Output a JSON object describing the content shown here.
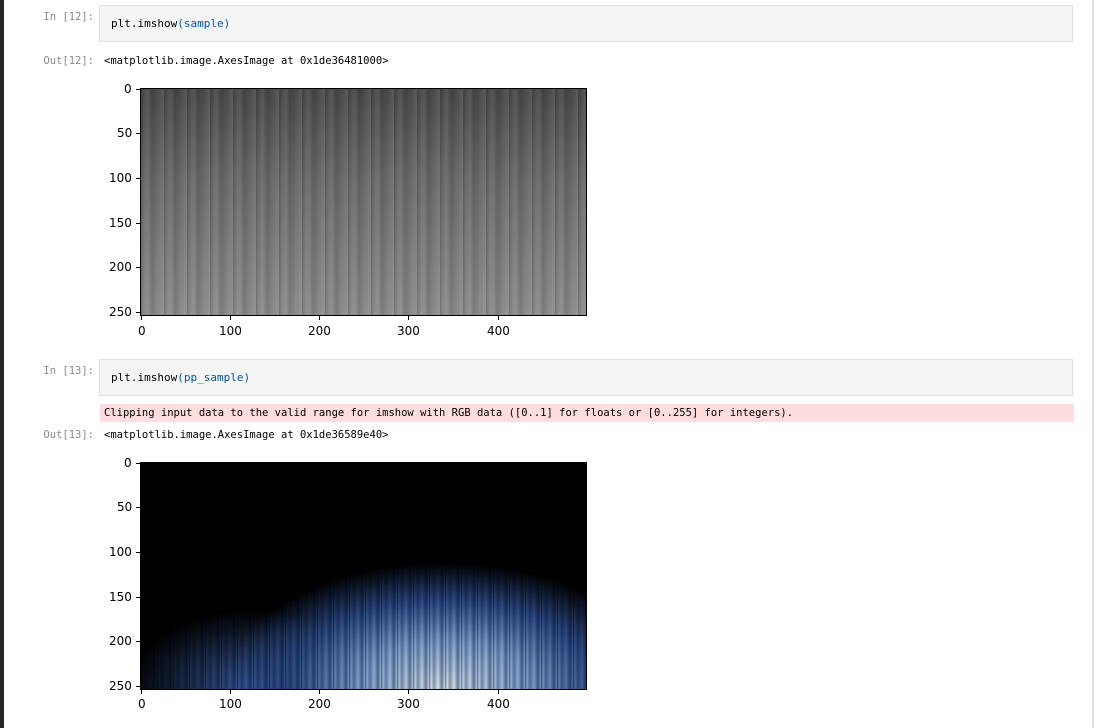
{
  "cells": [
    {
      "in_prompt": "In [12]:",
      "code_fn": "plt.imshow",
      "code_arg": "(sample)",
      "out_prompt": "Out[12]:",
      "output_text": "<matplotlib.image.AxesImage at 0x1de36481000>",
      "plot": {
        "image": "grayscale wood texture",
        "yticks": [
          "0",
          "50",
          "100",
          "150",
          "200",
          "250"
        ],
        "xticks": [
          "0",
          "100",
          "200",
          "300",
          "400"
        ]
      }
    },
    {
      "in_prompt": "In [13]:",
      "code_fn": "plt.imshow",
      "code_arg": "(pp_sample)",
      "stderr": "Clipping input data to the valid range for imshow with RGB data ([0..1] for floats or [0..255] for integers).",
      "out_prompt": "Out[13]:",
      "output_text": "<matplotlib.image.AxesImage at 0x1de36589e40>",
      "plot": {
        "image": "dark image with blue highlights",
        "yticks": [
          "0",
          "50",
          "100",
          "150",
          "200",
          "250"
        ],
        "xticks": [
          "0",
          "100",
          "200",
          "300",
          "400"
        ]
      }
    }
  ],
  "colors": {
    "stderr_bg": "#fddddd",
    "cell_bg": "#f5f5f5",
    "prompt": "#8a8a8a"
  }
}
